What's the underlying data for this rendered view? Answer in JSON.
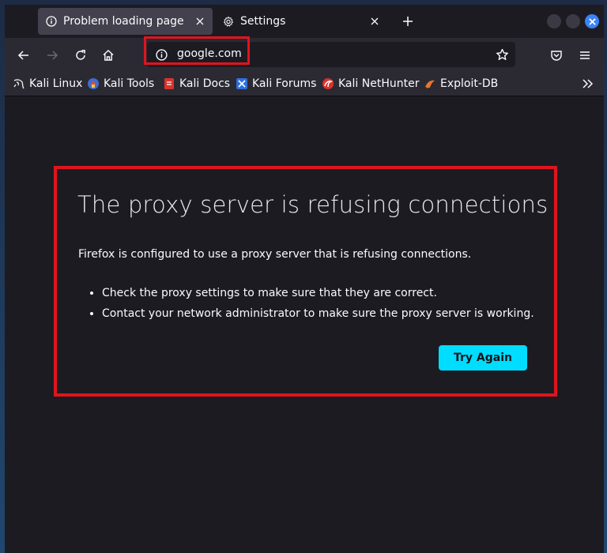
{
  "tabs": [
    {
      "label": "Problem loading page",
      "icon": "info-icon",
      "active": true
    },
    {
      "label": "Settings",
      "icon": "gear-icon",
      "active": false
    }
  ],
  "toolbar": {
    "url": "google.com"
  },
  "bookmarks": [
    {
      "label": "Kali Linux",
      "icon": "kali-dragon-icon"
    },
    {
      "label": "Kali Tools",
      "icon": "kali-tools-icon"
    },
    {
      "label": "Kali Docs",
      "icon": "kali-docs-icon"
    },
    {
      "label": "Kali Forums",
      "icon": "kali-forums-icon"
    },
    {
      "label": "Kali NetHunter",
      "icon": "kali-nethunter-icon"
    },
    {
      "label": "Exploit-DB",
      "icon": "exploit-db-icon"
    }
  ],
  "error": {
    "title": "The proxy server is refusing connections",
    "description": "Firefox is configured to use a proxy server that is refusing connections.",
    "suggestions": [
      "Check the proxy settings to make sure that they are correct.",
      "Contact your network administrator to make sure the proxy server is working."
    ],
    "try_again_label": "Try Again"
  },
  "colors": {
    "highlight": "#e0141e",
    "button": "#00ddff",
    "background": "#1c1b22",
    "toolbar": "#2b2a33"
  }
}
